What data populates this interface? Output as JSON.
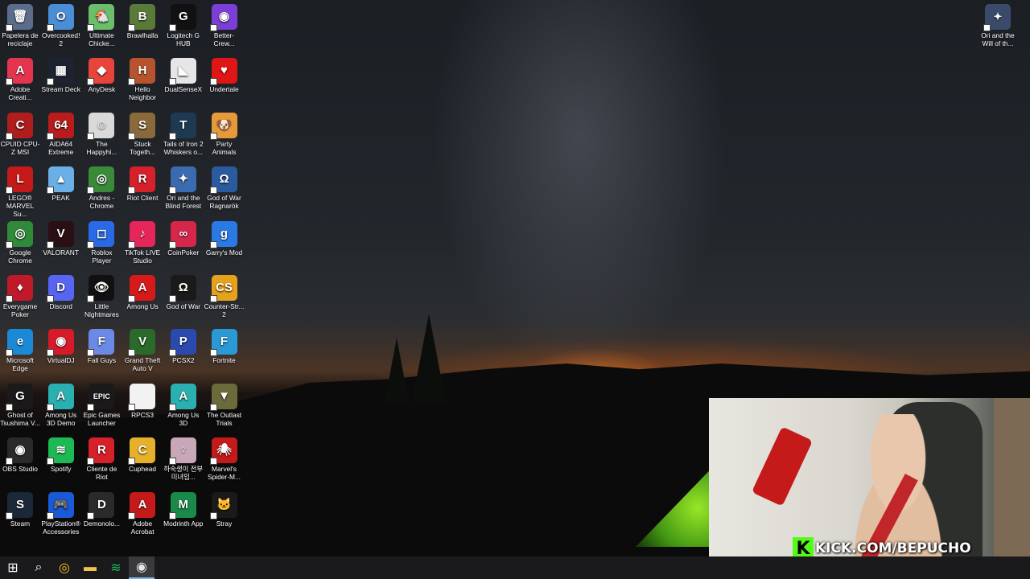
{
  "desktop_icons": [
    {
      "label": "Papelera de reciclaje",
      "col": 0,
      "row": 0,
      "color": "#5a6e8c",
      "glyph": "🗑"
    },
    {
      "label": "Overcooked! 2",
      "col": 1,
      "row": 0,
      "color": "#4a8fd6",
      "glyph": "O"
    },
    {
      "label": "Ultimate Chicke...",
      "col": 2,
      "row": 0,
      "color": "#6bbf6b",
      "glyph": "🐔"
    },
    {
      "label": "Brawlhalla",
      "col": 3,
      "row": 0,
      "color": "#5a7a3a",
      "glyph": "B"
    },
    {
      "label": "Logitech G HUB",
      "col": 4,
      "row": 0,
      "color": "#111111",
      "glyph": "G"
    },
    {
      "label": "Better-Crew...",
      "col": 5,
      "row": 0,
      "color": "#7b3fd6",
      "glyph": "◉"
    },
    {
      "label": "Adobe Creati...",
      "col": 0,
      "row": 1,
      "color": "#e5344e",
      "glyph": "A"
    },
    {
      "label": "Stream Deck",
      "col": 1,
      "row": 1,
      "color": "#1d2330",
      "glyph": "▦"
    },
    {
      "label": "AnyDesk",
      "col": 2,
      "row": 1,
      "color": "#e8443b",
      "glyph": "◆"
    },
    {
      "label": "Hello Neighbor",
      "col": 3,
      "row": 1,
      "color": "#b8542d",
      "glyph": "H"
    },
    {
      "label": "DualSenseX",
      "col": 4,
      "row": 1,
      "color": "#e6e6e6",
      "glyph": "◣"
    },
    {
      "label": "Undertale",
      "col": 5,
      "row": 1,
      "color": "#e01515",
      "glyph": "♥"
    },
    {
      "label": "CPUID CPU-Z MSI",
      "col": 0,
      "row": 2,
      "color": "#b01d1d",
      "glyph": "C"
    },
    {
      "label": "AIDA64 Extreme",
      "col": 1,
      "row": 2,
      "color": "#b81c1c",
      "glyph": "64"
    },
    {
      "label": "The Happyhi...",
      "col": 2,
      "row": 2,
      "color": "#d9d9d9",
      "glyph": "☺"
    },
    {
      "label": "Stuck Togeth...",
      "col": 3,
      "row": 2,
      "color": "#8a6a3a",
      "glyph": "S"
    },
    {
      "label": "Tails of Iron 2 Whiskers o...",
      "col": 4,
      "row": 2,
      "color": "#1e3a52",
      "glyph": "T"
    },
    {
      "label": "Party Animals",
      "col": 5,
      "row": 2,
      "color": "#e69a3a",
      "glyph": "🐶"
    },
    {
      "label": "LEGO® MARVEL Su...",
      "col": 0,
      "row": 3,
      "color": "#c41a1a",
      "glyph": "L"
    },
    {
      "label": "PEAK",
      "col": 1,
      "row": 3,
      "color": "#6ab0e6",
      "glyph": "▲"
    },
    {
      "label": "Andres - Chrome",
      "col": 2,
      "row": 3,
      "color": "#3a8a3a",
      "glyph": "◎"
    },
    {
      "label": "Riot Client",
      "col": 3,
      "row": 3,
      "color": "#d6202a",
      "glyph": "R"
    },
    {
      "label": "Ori and the Blind Forest",
      "col": 4,
      "row": 3,
      "color": "#3a6ab0",
      "glyph": "✦"
    },
    {
      "label": "God of War Ragnarök",
      "col": 5,
      "row": 3,
      "color": "#2a5aa0",
      "glyph": "Ω"
    },
    {
      "label": "Google Chrome",
      "col": 0,
      "row": 4,
      "color": "#2f8a3a",
      "glyph": "◎"
    },
    {
      "label": "VALORANT",
      "col": 1,
      "row": 4,
      "color": "#2a0f14",
      "glyph": "V"
    },
    {
      "label": "Roblox Player",
      "col": 2,
      "row": 4,
      "color": "#2a6ae6",
      "glyph": "◻"
    },
    {
      "label": "TikTok LIVE Studio",
      "col": 3,
      "row": 4,
      "color": "#e6265a",
      "glyph": "♪"
    },
    {
      "label": "CoinPoker",
      "col": 4,
      "row": 4,
      "color": "#d6264a",
      "glyph": "∞"
    },
    {
      "label": "Garry's Mod",
      "col": 5,
      "row": 4,
      "color": "#2a7ae6",
      "glyph": "g"
    },
    {
      "label": "Everygame Poker",
      "col": 0,
      "row": 5,
      "color": "#c01a2a",
      "glyph": "♦"
    },
    {
      "label": "Discord",
      "col": 1,
      "row": 5,
      "color": "#5865f2",
      "glyph": "D"
    },
    {
      "label": "Little Nightmares",
      "col": 2,
      "row": 5,
      "color": "#111111",
      "glyph": "👁"
    },
    {
      "label": "Among Us",
      "col": 3,
      "row": 5,
      "color": "#d61a1a",
      "glyph": "A"
    },
    {
      "label": "God of War",
      "col": 4,
      "row": 5,
      "color": "#1a1a1a",
      "glyph": "Ω"
    },
    {
      "label": "Counter-Str... 2",
      "col": 5,
      "row": 5,
      "color": "#e6a21a",
      "glyph": "CS"
    },
    {
      "label": "Microsoft Edge",
      "col": 0,
      "row": 6,
      "color": "#1a8ad6",
      "glyph": "e"
    },
    {
      "label": "VirtualDJ",
      "col": 1,
      "row": 6,
      "color": "#d61a2a",
      "glyph": "◉"
    },
    {
      "label": "Fall Guys",
      "col": 2,
      "row": 6,
      "color": "#6a8ae6",
      "glyph": "F"
    },
    {
      "label": "Grand Theft Auto V",
      "col": 3,
      "row": 6,
      "color": "#2a6a2a",
      "glyph": "V"
    },
    {
      "label": "PCSX2",
      "col": 4,
      "row": 6,
      "color": "#2a4ab0",
      "glyph": "P"
    },
    {
      "label": "Fortnite",
      "col": 5,
      "row": 6,
      "color": "#2a9ad6",
      "glyph": "F"
    },
    {
      "label": "Ghost of Tsushima V...",
      "col": 0,
      "row": 7,
      "color": "#1a1a1a",
      "glyph": "G"
    },
    {
      "label": "Among Us 3D Demo",
      "col": 1,
      "row": 7,
      "color": "#2ab0b0",
      "glyph": "A"
    },
    {
      "label": "Epic Games Launcher",
      "col": 2,
      "row": 7,
      "color": "#1a1a1a",
      "glyph": "EPIC"
    },
    {
      "label": "RPCS3",
      "col": 3,
      "row": 7,
      "color": "#f2f2f2",
      "glyph": ""
    },
    {
      "label": "Among Us 3D",
      "col": 4,
      "row": 7,
      "color": "#2ab0b0",
      "glyph": "A"
    },
    {
      "label": "The Outlast Trials",
      "col": 5,
      "row": 7,
      "color": "#6a6a3a",
      "glyph": "▼"
    },
    {
      "label": "OBS Studio",
      "col": 0,
      "row": 8,
      "color": "#2a2a2a",
      "glyph": "◉"
    },
    {
      "label": "Spotify",
      "col": 1,
      "row": 8,
      "color": "#1db954",
      "glyph": "≋"
    },
    {
      "label": "Cliente de Riot",
      "col": 2,
      "row": 8,
      "color": "#d6202a",
      "glyph": "R"
    },
    {
      "label": "Cuphead",
      "col": 3,
      "row": 8,
      "color": "#e6b02a",
      "glyph": "C"
    },
    {
      "label": "하숙생이 전부 미녀임...",
      "col": 4,
      "row": 8,
      "color": "#c8a8b8",
      "glyph": "♀"
    },
    {
      "label": "Marvel's Spider-M...",
      "col": 5,
      "row": 8,
      "color": "#c41a1a",
      "glyph": "🕷"
    },
    {
      "label": "Steam",
      "col": 0,
      "row": 9,
      "color": "#1b2838",
      "glyph": "S"
    },
    {
      "label": "PlayStation® Accessories",
      "col": 1,
      "row": 9,
      "color": "#1a5ad6",
      "glyph": "🎮"
    },
    {
      "label": "Demonolo...",
      "col": 2,
      "row": 9,
      "color": "#2a2a2a",
      "glyph": "D"
    },
    {
      "label": "Adobe Acrobat",
      "col": 3,
      "row": 9,
      "color": "#c41a1a",
      "glyph": "A"
    },
    {
      "label": "Modrinth App",
      "col": 4,
      "row": 9,
      "color": "#1a8a4a",
      "glyph": "M"
    },
    {
      "label": "Stray",
      "col": 5,
      "row": 9,
      "color": "#1a1a1a",
      "glyph": "🐱"
    }
  ],
  "corner_icon": {
    "label": "Ori and the Will of th...",
    "color": "#3a4a6a",
    "glyph": "✦"
  },
  "overlay": {
    "kick_text": "KICK.COM/BEPUCHO",
    "kick_glyph": "K"
  },
  "taskbar": {
    "items": [
      {
        "name": "start",
        "glyph": "⊞"
      },
      {
        "name": "search",
        "glyph": "⌕"
      },
      {
        "name": "chrome",
        "glyph": "◎"
      },
      {
        "name": "file-explorer",
        "glyph": "▬"
      },
      {
        "name": "spotify",
        "glyph": "≋"
      },
      {
        "name": "obs",
        "glyph": "◉"
      }
    ]
  }
}
